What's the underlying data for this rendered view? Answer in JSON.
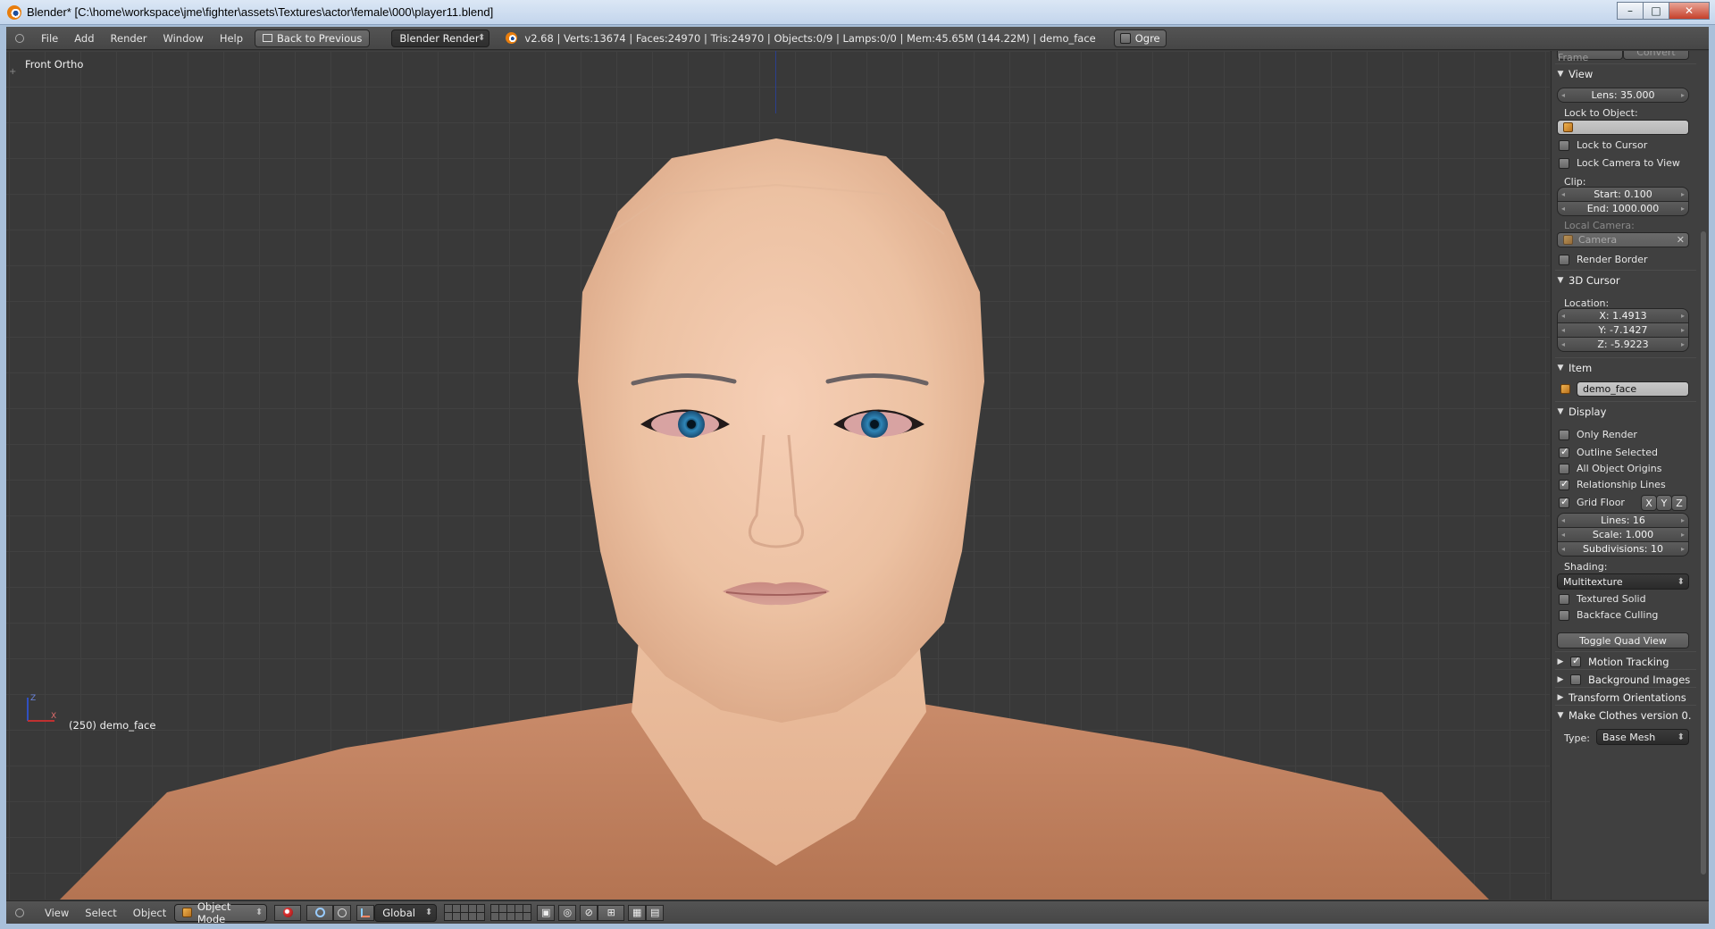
{
  "window": {
    "title": "Blender* [C:\\home\\workspace\\jme\\fighter\\assets\\Textures\\actor\\female\\000\\player11.blend]",
    "min_glyph": "–",
    "max_glyph": "□",
    "close_glyph": "✕"
  },
  "header": {
    "menus": [
      "File",
      "Add",
      "Render",
      "Window",
      "Help"
    ],
    "back_button": "Back to Previous",
    "render_engine": "Blender Render",
    "stats": "v2.68 | Verts:13674 | Faces:24970 | Tris:24970 | Objects:0/9 | Lamps:0/0 | Mem:45.65M (144.22M) | demo_face",
    "ogre_label": "Ogre"
  },
  "viewport": {
    "view_name": "Front Ortho",
    "object_info": "(250) demo_face",
    "axis_z": "Z",
    "axis_x": "X"
  },
  "panel": {
    "cut_top_left": "Delete Frame",
    "cut_top_right": "Convert",
    "view_header": "View",
    "lens": "Lens: 35.000",
    "lock_to_object": "Lock to Object:",
    "lock_to_cursor": "Lock to Cursor",
    "lock_camera_to_view": "Lock Camera to View",
    "clip": "Clip:",
    "clip_start": "Start: 0.100",
    "clip_end": "End: 1000.000",
    "local_camera": "Local Camera:",
    "camera_field": "Camera",
    "render_border": "Render Border",
    "cursor_header": "3D Cursor",
    "location": "Location:",
    "cursor_x": "X: 1.4913",
    "cursor_y": "Y: -7.1427",
    "cursor_z": "Z: -5.9223",
    "item_header": "Item",
    "item_name": "demo_face",
    "display_header": "Display",
    "only_render": "Only Render",
    "outline_selected": "Outline Selected",
    "all_object_origins": "All Object Origins",
    "relationship_lines": "Relationship Lines",
    "grid_floor": "Grid Floor",
    "grid_x": "X",
    "grid_y": "Y",
    "grid_z": "Z",
    "lines": "Lines: 16",
    "scale": "Scale: 1.000",
    "subdivisions": "Subdivisions: 10",
    "shading": "Shading:",
    "shading_mode": "Multitexture",
    "textured_solid": "Textured Solid",
    "backface_culling": "Backface Culling",
    "toggle_quad_view": "Toggle Quad View",
    "motion_tracking": "Motion Tracking",
    "background_images": "Background Images",
    "transform_orientations": "Transform Orientations",
    "make_clothes": "Make Clothes version 0.",
    "type_label": "Type:",
    "type_value": "Base Mesh"
  },
  "footer": {
    "view": "View",
    "select": "Select",
    "object": "Object",
    "mode": "Object Mode",
    "orientation": "Global"
  }
}
